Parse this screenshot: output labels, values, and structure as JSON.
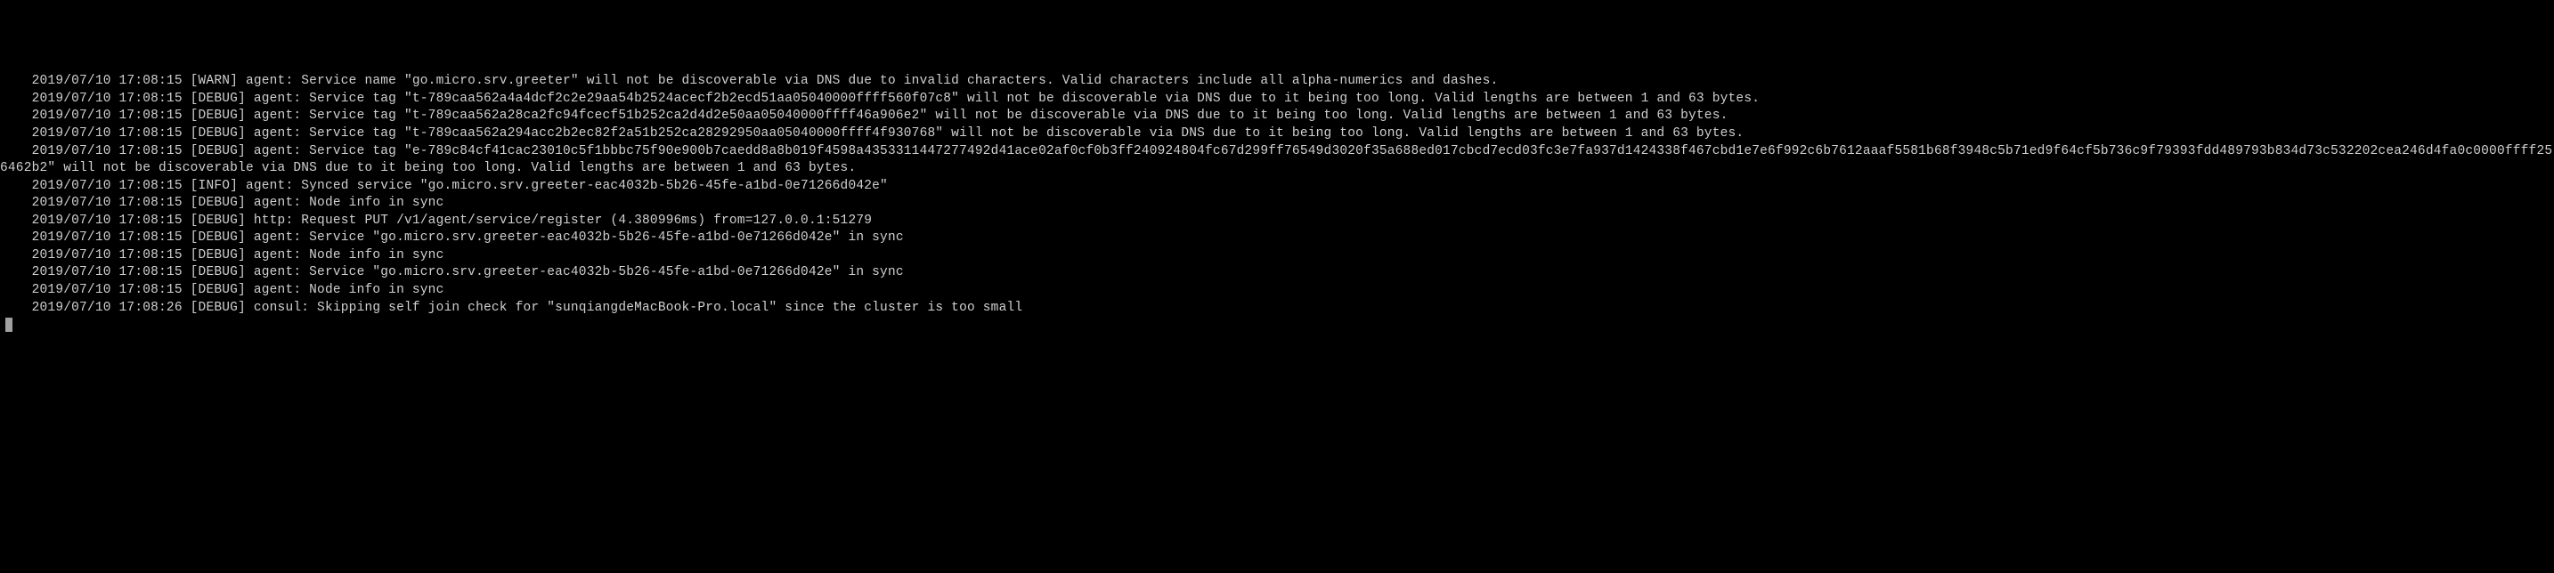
{
  "logs": [
    "    2019/07/10 17:08:15 [WARN] agent: Service name \"go.micro.srv.greeter\" will not be discoverable via DNS due to invalid characters. Valid characters include all alpha-numerics and dashes.",
    "    2019/07/10 17:08:15 [DEBUG] agent: Service tag \"t-789caa562a4a4dcf2c2e29aa54b2524acecf2b2ecd51aa05040000ffff560f07c8\" will not be discoverable via DNS due to it being too long. Valid lengths are between 1 and 63 bytes.",
    "    2019/07/10 17:08:15 [DEBUG] agent: Service tag \"t-789caa562a28ca2fc94fcecf51b252ca2d4d2e50aa05040000ffff46a906e2\" will not be discoverable via DNS due to it being too long. Valid lengths are between 1 and 63 bytes.",
    "    2019/07/10 17:08:15 [DEBUG] agent: Service tag \"t-789caa562a294acc2b2ec82f2a51b252ca28292950aa05040000ffff4f930768\" will not be discoverable via DNS due to it being too long. Valid lengths are between 1 and 63 bytes.",
    "    2019/07/10 17:08:15 [DEBUG] agent: Service tag \"e-789c84cf41cac23010c5f1bbbc75f90e900b7caedd8a8b019f4598a4353311447277492d41ace02af0cf0b3ff240924804fc67d299ff76549d3020f35a688ed017cbcd7ecd03fc3e7fa937d1424338f467cbd1e7e6f992c6b7612aaaf5581b68f3948c5b71ed9f64cf5b736c9f79393fdd489793b834d73c532202cea246d4fa0c0000ffff256462b2\" will not be discoverable via DNS due to it being too long. Valid lengths are between 1 and 63 bytes.",
    "    2019/07/10 17:08:15 [INFO] agent: Synced service \"go.micro.srv.greeter-eac4032b-5b26-45fe-a1bd-0e71266d042e\"",
    "    2019/07/10 17:08:15 [DEBUG] agent: Node info in sync",
    "    2019/07/10 17:08:15 [DEBUG] http: Request PUT /v1/agent/service/register (4.380996ms) from=127.0.0.1:51279",
    "    2019/07/10 17:08:15 [DEBUG] agent: Service \"go.micro.srv.greeter-eac4032b-5b26-45fe-a1bd-0e71266d042e\" in sync",
    "    2019/07/10 17:08:15 [DEBUG] agent: Node info in sync",
    "    2019/07/10 17:08:15 [DEBUG] agent: Service \"go.micro.srv.greeter-eac4032b-5b26-45fe-a1bd-0e71266d042e\" in sync",
    "    2019/07/10 17:08:15 [DEBUG] agent: Node info in sync",
    "    2019/07/10 17:08:26 [DEBUG] consul: Skipping self join check for \"sunqiangdeMacBook-Pro.local\" since the cluster is too small"
  ]
}
